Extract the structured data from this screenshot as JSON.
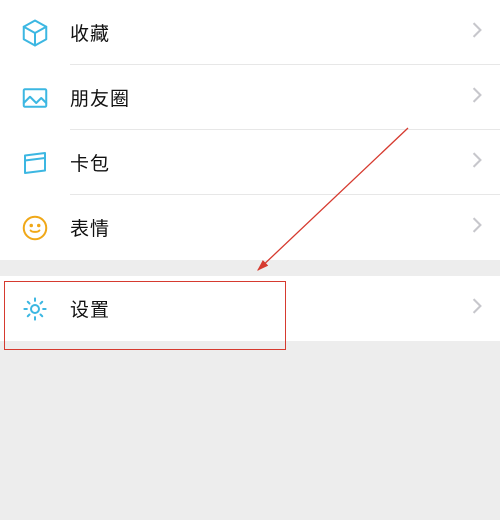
{
  "menu": {
    "group1": [
      {
        "name": "favorites",
        "label": "收藏",
        "icon": "cube-icon"
      },
      {
        "name": "moments",
        "label": "朋友圈",
        "icon": "photo-icon"
      },
      {
        "name": "cards",
        "label": "卡包",
        "icon": "wallet-icon"
      },
      {
        "name": "stickers",
        "label": "表情",
        "icon": "smile-icon"
      }
    ],
    "group2": [
      {
        "name": "settings",
        "label": "设置",
        "icon": "gear-icon"
      }
    ]
  },
  "colors": {
    "icon_blue": "#3cb7e2",
    "icon_yellow": "#f0a818",
    "icon_annot": "#d63a2f"
  }
}
